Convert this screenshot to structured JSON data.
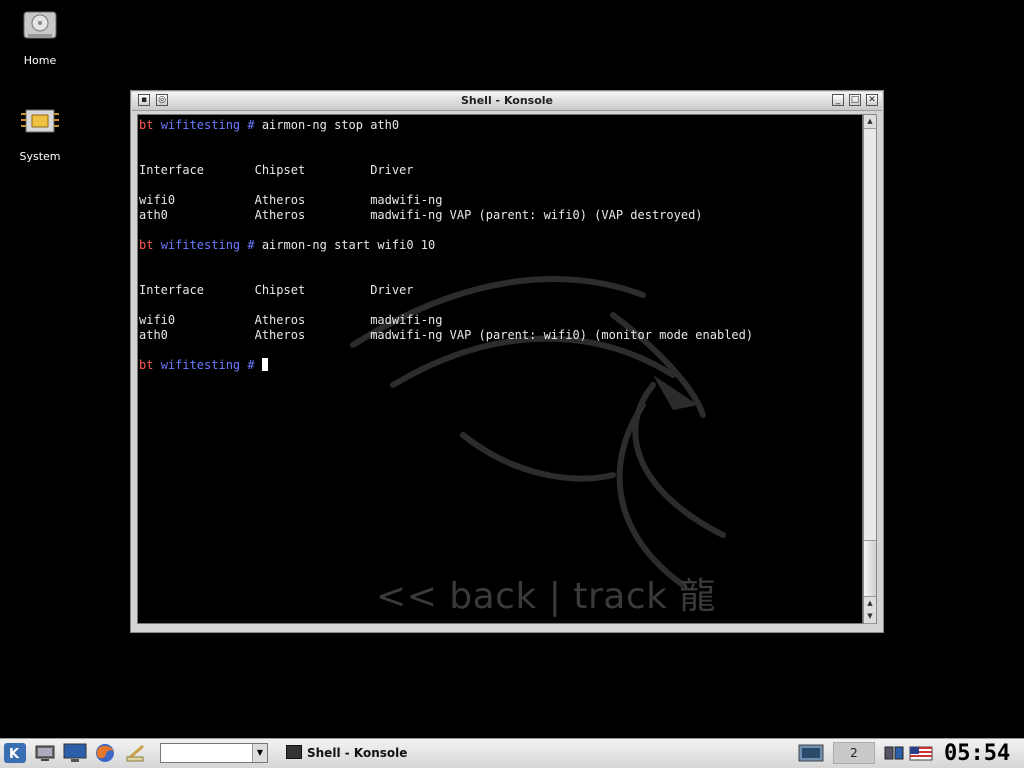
{
  "desktop": {
    "icons": [
      {
        "label": "Home",
        "icon": "hard-drive-icon"
      },
      {
        "label": "System",
        "icon": "chip-icon"
      }
    ]
  },
  "window": {
    "title": "Shell - Konsole"
  },
  "terminal": {
    "prompt_host": "bt",
    "prompt_dir": "wifitesting #",
    "lines": [
      {
        "type": "prompt",
        "cmd": " airmon-ng stop ath0"
      },
      {
        "type": "blank"
      },
      {
        "type": "blank"
      },
      {
        "type": "text",
        "text": "Interface       Chipset         Driver"
      },
      {
        "type": "blank"
      },
      {
        "type": "text",
        "text": "wifi0           Atheros         madwifi-ng"
      },
      {
        "type": "text",
        "text": "ath0            Atheros         madwifi-ng VAP (parent: wifi0) (VAP destroyed)"
      },
      {
        "type": "blank"
      },
      {
        "type": "prompt",
        "cmd": " airmon-ng start wifi0 10"
      },
      {
        "type": "blank"
      },
      {
        "type": "blank"
      },
      {
        "type": "text",
        "text": "Interface       Chipset         Driver"
      },
      {
        "type": "blank"
      },
      {
        "type": "text",
        "text": "wifi0           Atheros         madwifi-ng"
      },
      {
        "type": "text",
        "text": "ath0            Atheros         madwifi-ng VAP (parent: wifi0) (monitor mode enabled)"
      },
      {
        "type": "blank"
      },
      {
        "type": "prompt",
        "cmd": " ",
        "cursor": true
      }
    ],
    "watermark": "<< back | track 龍"
  },
  "taskbar": {
    "task_label": "Shell - Konsole",
    "pager_label": "2",
    "clock": "05:54",
    "quicklaunch": [
      "kde-menu-icon",
      "show-desktop-icon",
      "monitor-icon",
      "firefox-icon",
      "konqueror-icon"
    ]
  }
}
